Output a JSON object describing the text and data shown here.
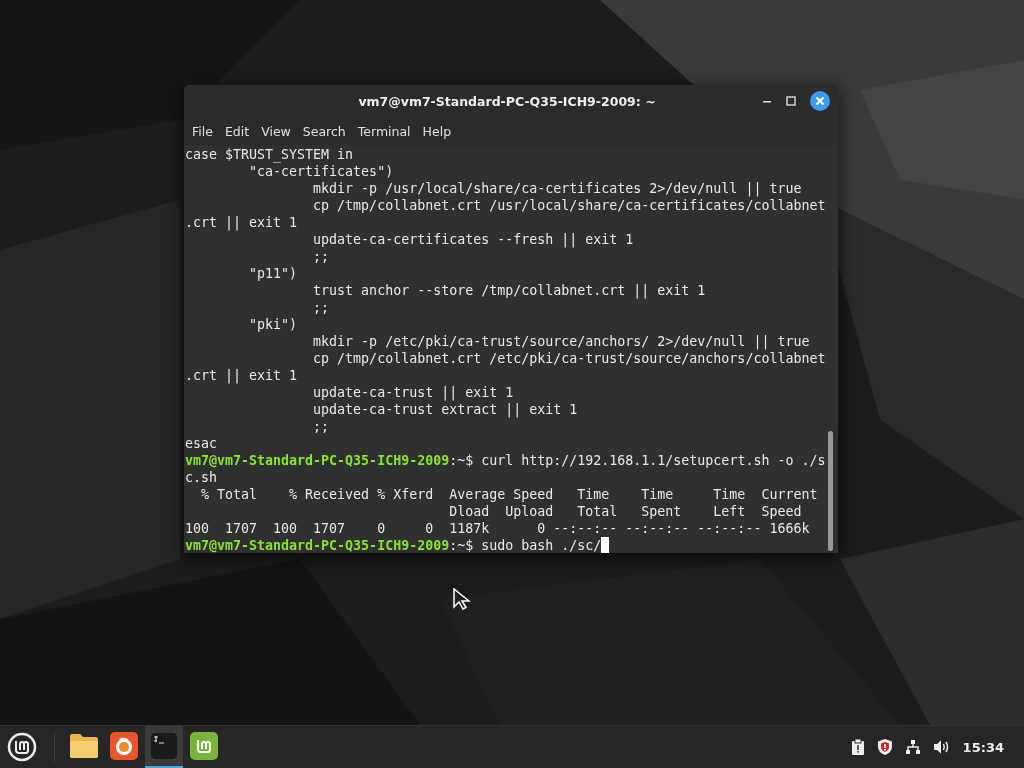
{
  "window": {
    "title": "vm7@vm7-Standard-PC-Q35-ICH9-2009: ~"
  },
  "menu": [
    "File",
    "Edit",
    "View",
    "Search",
    "Terminal",
    "Help"
  ],
  "terminal": {
    "lines": [
      {
        "kind": "plain",
        "text": "case $TRUST_SYSTEM in"
      },
      {
        "kind": "plain",
        "text": "        \"ca-certificates\")"
      },
      {
        "kind": "plain",
        "text": "                mkdir -p /usr/local/share/ca-certificates 2>/dev/null || true"
      },
      {
        "kind": "plain",
        "text": "                cp /tmp/collabnet.crt /usr/local/share/ca-certificates/collabnet"
      },
      {
        "kind": "plain",
        "text": ".crt || exit 1"
      },
      {
        "kind": "plain",
        "text": "                update-ca-certificates --fresh || exit 1"
      },
      {
        "kind": "plain",
        "text": "                ;;"
      },
      {
        "kind": "plain",
        "text": "        \"p11\")"
      },
      {
        "kind": "plain",
        "text": "                trust anchor --store /tmp/collabnet.crt || exit 1"
      },
      {
        "kind": "plain",
        "text": "                ;;"
      },
      {
        "kind": "plain",
        "text": "        \"pki\")"
      },
      {
        "kind": "plain",
        "text": "                mkdir -p /etc/pki/ca-trust/source/anchors/ 2>/dev/null || true"
      },
      {
        "kind": "plain",
        "text": "                cp /tmp/collabnet.crt /etc/pki/ca-trust/source/anchors/collabnet"
      },
      {
        "kind": "plain",
        "text": ".crt || exit 1"
      },
      {
        "kind": "plain",
        "text": "                update-ca-trust || exit 1"
      },
      {
        "kind": "plain",
        "text": "                update-ca-trust extract || exit 1"
      },
      {
        "kind": "plain",
        "text": "                ;;"
      },
      {
        "kind": "plain",
        "text": "esac"
      },
      {
        "kind": "prompt",
        "user_host": "vm7@vm7-Standard-PC-Q35-ICH9-2009",
        "text": ":~$ curl http://192.168.1.1/setupcert.sh -o ./s",
        "cursor": false
      },
      {
        "kind": "plain",
        "text": "c.sh"
      },
      {
        "kind": "plain",
        "text": "  % Total    % Received % Xferd  Average Speed   Time    Time     Time  Current"
      },
      {
        "kind": "plain",
        "text": "                                 Dload  Upload   Total   Spent    Left  Speed"
      },
      {
        "kind": "plain",
        "text": "100  1707  100  1707    0     0  1187k      0 --:--:-- --:--:-- --:--:-- 1666k"
      },
      {
        "kind": "prompt",
        "user_host": "vm7@vm7-Standard-PC-Q35-ICH9-2009",
        "text": ":~$ sudo bash ./sc/",
        "cursor": true
      }
    ]
  },
  "taskbar": {
    "apps": [
      {
        "kind": "files",
        "active": false
      },
      {
        "kind": "browser",
        "active": false
      },
      {
        "kind": "terminal",
        "active": true
      },
      {
        "kind": "mint",
        "active": false
      }
    ],
    "clock": "15:34"
  }
}
